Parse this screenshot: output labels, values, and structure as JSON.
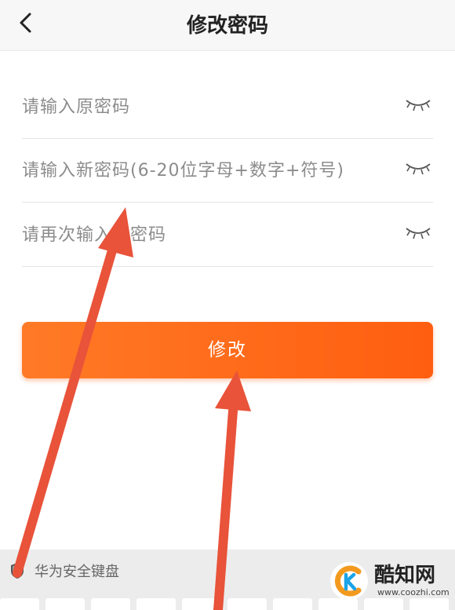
{
  "header": {
    "title": "修改密码",
    "back_icon": "chevron-left-icon"
  },
  "form": {
    "fields": [
      {
        "placeholder": "请输入原密码",
        "icon": "eye-closed-icon"
      },
      {
        "placeholder": "请输入新密码(6-20位字母+数字+符号)",
        "icon": "eye-closed-icon"
      },
      {
        "placeholder": "请再次输入新密码",
        "icon": "eye-closed-icon"
      }
    ],
    "submit_label": "修改",
    "submit_color": "#ff6a1a"
  },
  "keyboard": {
    "label": "华为安全键盘",
    "icon": "shield-icon"
  },
  "watermark": {
    "name": "酷知网",
    "url": "www.coozhi.com"
  },
  "annotation_color": "#e8533a"
}
